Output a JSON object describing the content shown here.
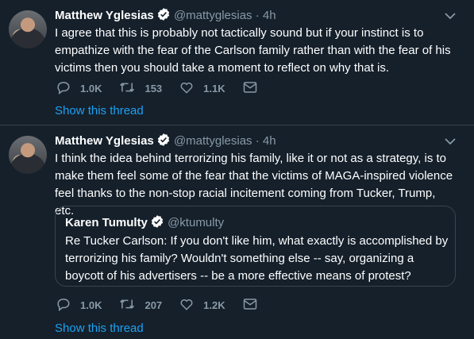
{
  "tweets": [
    {
      "name": "Matthew Yglesias",
      "handle": "@mattyglesias",
      "dot": "·",
      "time": "4h",
      "text": "I agree that this is probably not tactically sound but if your instinct is to empathize with the fear of the Carlson family rather than with the fear of his victims then you should take a moment to reflect on why that is.",
      "replies": "1.0K",
      "retweets": "153",
      "likes": "1.1K",
      "show_thread": "Show this thread"
    },
    {
      "name": "Matthew Yglesias",
      "handle": "@mattyglesias",
      "dot": "·",
      "time": "4h",
      "text": "I think the idea behind terrorizing his family, like it or not as a strategy, is to make them feel some of the fear that the victims of MAGA-inspired violence feel thanks to the non-stop racial incitement coming from Tucker, Trump, etc.",
      "quote": {
        "name": "Karen Tumulty",
        "handle": "@ktumulty",
        "text": "Re Tucker Carlson: If you don't like him, what exactly is accomplished by terrorizing his family? Wouldn't something else -- say, organizing a boycott of his advertisers -- be a more effective means of protest?"
      },
      "replies": "1.0K",
      "retweets": "207",
      "likes": "1.2K",
      "show_thread": "Show this thread"
    }
  ],
  "icons": {
    "verified": "verified-badge-icon",
    "reply": "reply-icon",
    "retweet": "retweet-icon",
    "like": "heart-icon",
    "dm": "envelope-icon",
    "menu": "chevron-down-icon"
  },
  "colors": {
    "background": "#15202b",
    "muted": "#8899a6",
    "accent": "#1da1f2",
    "divider": "#38444d"
  }
}
